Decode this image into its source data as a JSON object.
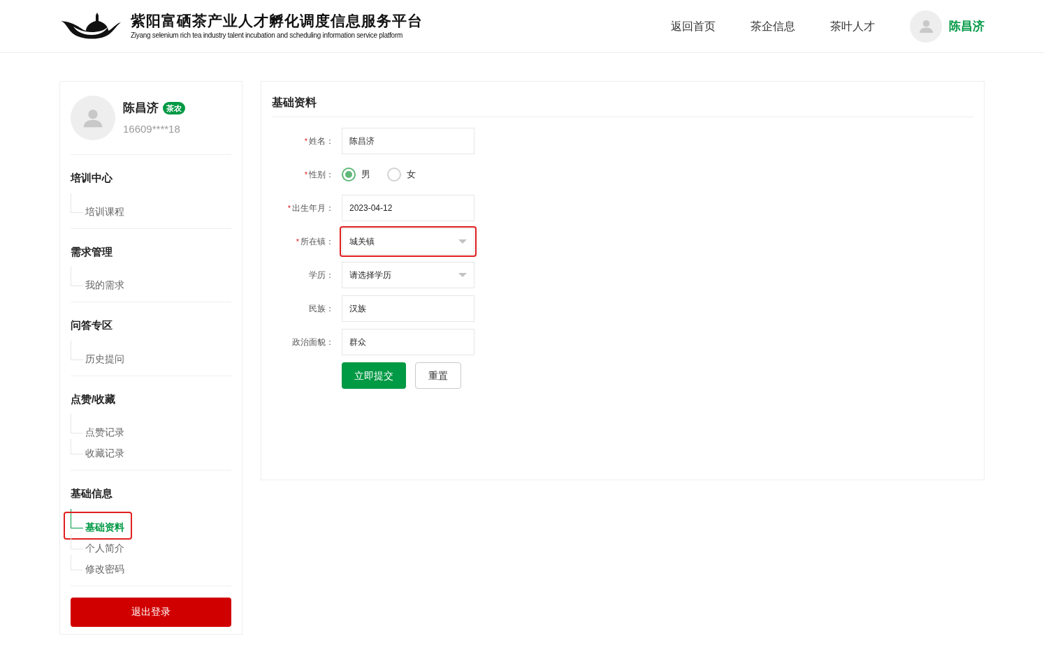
{
  "header": {
    "title": "紫阳富硒茶产业人才孵化调度信息服务平台",
    "subtitle": "Ziyang selenium rich tea industry talent incubation and scheduling information service platform",
    "nav": [
      {
        "label": "返回首页"
      },
      {
        "label": "茶企信息"
      },
      {
        "label": "茶叶人才"
      }
    ],
    "user_name": "陈昌济"
  },
  "profile": {
    "name": "陈昌济",
    "badge": "茶农",
    "phone": "16609****18"
  },
  "menu": [
    {
      "title": "培训中心",
      "children": [
        {
          "label": "培训课程",
          "selected": false,
          "highlighted": false
        }
      ]
    },
    {
      "title": "需求管理",
      "children": [
        {
          "label": "我的需求",
          "selected": false,
          "highlighted": false
        }
      ]
    },
    {
      "title": "问答专区",
      "children": [
        {
          "label": "历史提问",
          "selected": false,
          "highlighted": false
        }
      ]
    },
    {
      "title": "点赞/收藏",
      "children": [
        {
          "label": "点赞记录",
          "selected": false,
          "highlighted": false
        },
        {
          "label": "收藏记录",
          "selected": false,
          "highlighted": false
        }
      ]
    },
    {
      "title": "基础信息",
      "children": [
        {
          "label": "基础资料",
          "selected": true,
          "highlighted": true
        },
        {
          "label": "个人简介",
          "selected": false,
          "highlighted": false
        },
        {
          "label": "修改密码",
          "selected": false,
          "highlighted": false
        }
      ]
    }
  ],
  "logout": "退出登录",
  "form": {
    "title": "基础资料",
    "fields": [
      {
        "kind": "text",
        "label": "姓名：",
        "required_mark": "*",
        "value": "陈昌济",
        "highlighted": false
      },
      {
        "kind": "radio",
        "label": "性别：",
        "required_mark": "*",
        "options": [
          {
            "label": "男",
            "selected": true
          },
          {
            "label": "女",
            "selected": false
          }
        ]
      },
      {
        "kind": "text",
        "label": "出生年月：",
        "required_mark": "*",
        "value": "2023-04-12",
        "highlighted": false
      },
      {
        "kind": "select",
        "label": "所在镇：",
        "required_mark": "*",
        "value": "城关镇",
        "highlighted": true
      },
      {
        "kind": "select",
        "label": "学历：",
        "value": "请选择学历",
        "highlighted": false
      },
      {
        "kind": "text",
        "label": "民族：",
        "value": "汉族",
        "highlighted": false
      },
      {
        "kind": "text",
        "label": "政治面貌：",
        "value": "群众",
        "highlighted": false
      }
    ],
    "submit": "立即提交",
    "reset": "重置"
  }
}
